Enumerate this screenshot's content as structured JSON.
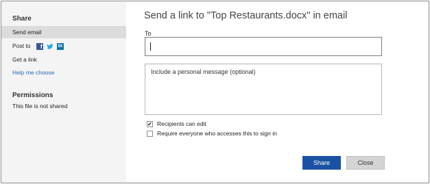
{
  "sidebar": {
    "share_heading": "Share",
    "items": [
      {
        "label": "Send email"
      },
      {
        "label": "Post to"
      },
      {
        "label": "Get a link"
      }
    ],
    "help_link": "Help me choose",
    "permissions_heading": "Permissions",
    "permissions_text": "This file is not shared",
    "social_icons": [
      "facebook-icon",
      "twitter-icon",
      "linkedin-icon"
    ]
  },
  "main": {
    "title": "Send a link to \"Top Restaurants.docx\" in email",
    "to_label": "To",
    "to_value": "",
    "message_placeholder": "Include a personal message (optional)",
    "checkboxes": [
      {
        "label": "Recipients can edit",
        "checked": true
      },
      {
        "label": "Require everyone who accesses this to sign in",
        "checked": false
      }
    ],
    "share_button": "Share",
    "close_button": "Close"
  },
  "colors": {
    "share_button_bg": "#1a52a3",
    "link": "#2368b8",
    "sidebar_bg": "#f4f4f4",
    "selected_bg": "#dcdcdc"
  }
}
